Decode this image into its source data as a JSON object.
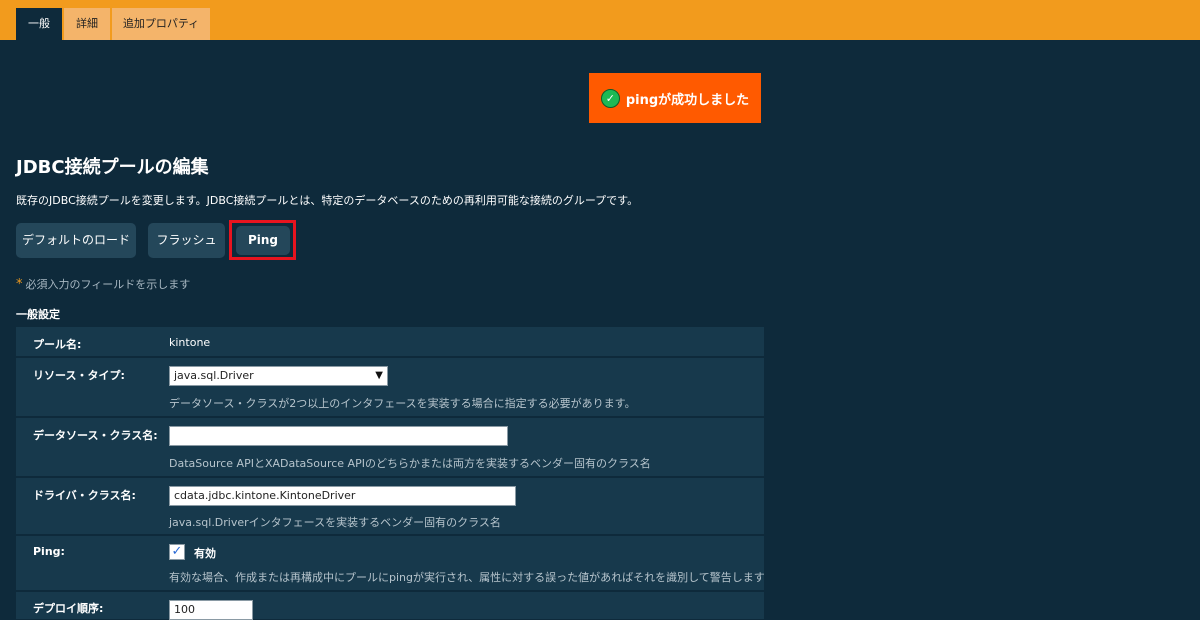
{
  "tabs": [
    {
      "label": "一般"
    },
    {
      "label": "詳細"
    },
    {
      "label": "追加プロパティ"
    }
  ],
  "alert": {
    "message": "pingが成功しました",
    "icon": "check-circle-icon"
  },
  "page": {
    "title": "JDBC接続プールの編集",
    "description": "既存のJDBC接続プールを変更します。JDBC接続プールとは、特定のデータベースのための再利用可能な接続のグループです。"
  },
  "buttons": {
    "load_defaults": "デフォルトのロード",
    "flush": "フラッシュ",
    "ping": "Ping"
  },
  "required_note": {
    "star": "*",
    "text": "必須入力のフィールドを示します"
  },
  "section_title": "一般設定",
  "fields": {
    "pool_name": {
      "label": "プール名:",
      "value": "kintone"
    },
    "resource_type": {
      "label": "リソース・タイプ:",
      "value": "java.sql.Driver",
      "hint": "データソース・クラスが2つ以上のインタフェースを実装する場合に指定する必要があります。"
    },
    "datasource_class": {
      "label": "データソース・クラス名:",
      "value": "",
      "hint": "DataSource APIとXADataSource APIのどちらかまたは両方を実装するベンダー固有のクラス名"
    },
    "driver_class": {
      "label": "ドライバ・クラス名:",
      "value": "cdata.jdbc.kintone.KintoneDriver",
      "hint": "java.sql.Driverインタフェースを実装するベンダー固有のクラス名"
    },
    "ping": {
      "label": "Ping:",
      "checkbox_label": "有効",
      "checked": true,
      "hint": "有効な場合、作成または再構成中にプールにpingが実行され、属性に対する誤った値があればそれを識別して警告します"
    },
    "deploy_order": {
      "label": "デプロイ順序:",
      "value": "100"
    }
  },
  "colors": {
    "topbar": "#f29b1d",
    "background": "#0e2a3b",
    "alert": "#ff5a00",
    "highlight": "#e8141f"
  }
}
